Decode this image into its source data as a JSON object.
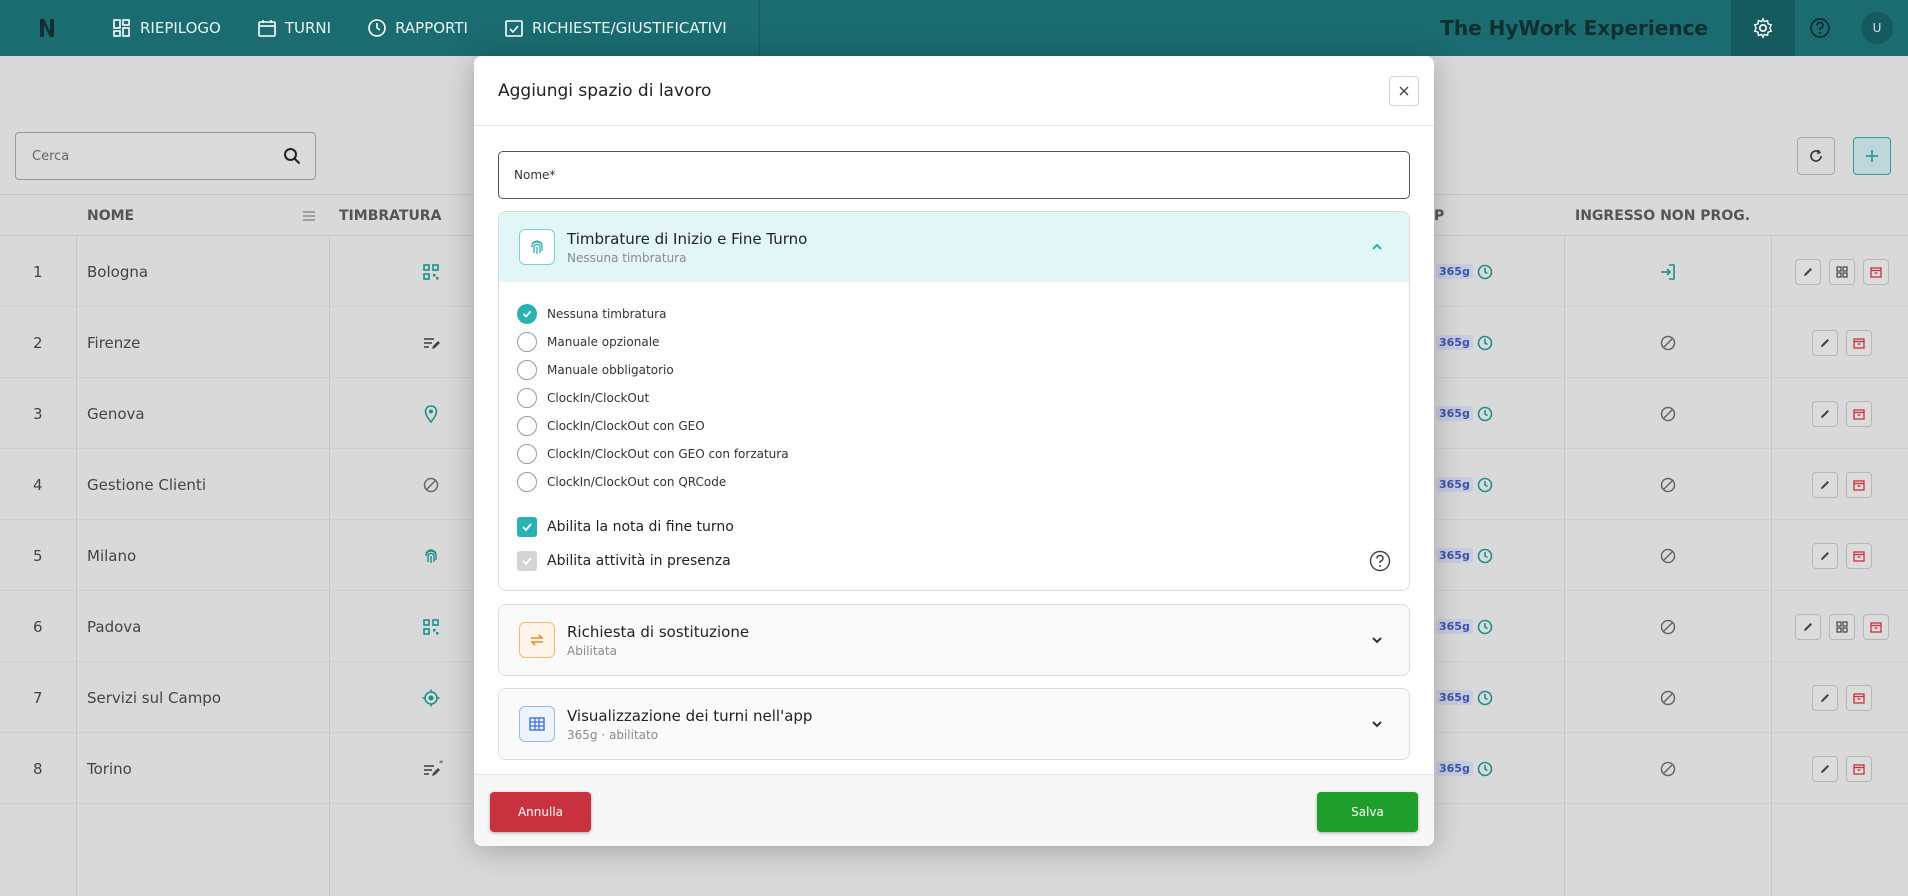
{
  "nav": {
    "items": [
      {
        "label": "RIEPILOGO",
        "icon": "dashboard-icon"
      },
      {
        "label": "TURNI",
        "icon": "calendar-icon"
      },
      {
        "label": "RAPPORTI",
        "icon": "clock-icon"
      },
      {
        "label": "RICHIESTE/GIUSTIFICATIVI",
        "icon": "check-calendar-icon"
      }
    ],
    "brand": "The HyWork Experience",
    "avatar": "U"
  },
  "search": {
    "placeholder": "Cerca"
  },
  "table": {
    "headers": {
      "nome": "NOME",
      "timbratura": "TIMBRATURA",
      "app": "P",
      "ingresso": "INGRESSO NON PROG."
    },
    "rows": [
      {
        "num": "1",
        "name": "Bologna",
        "tag": "365g",
        "icon": "qrcode-icon"
      },
      {
        "num": "2",
        "name": "Firenze",
        "tag": "365g",
        "icon": "manual-edit-icon"
      },
      {
        "num": "3",
        "name": "Genova",
        "tag": "365g",
        "icon": "location-pin-icon"
      },
      {
        "num": "4",
        "name": "Gestione Clienti",
        "tag": "365g",
        "icon": "blocked-icon"
      },
      {
        "num": "5",
        "name": "Milano",
        "tag": "365g",
        "icon": "fingerprint-icon"
      },
      {
        "num": "6",
        "name": "Padova",
        "tag": "365g",
        "icon": "qrcode-icon"
      },
      {
        "num": "7",
        "name": "Servizi sul Campo",
        "tag": "365g",
        "icon": "gps-target-icon"
      },
      {
        "num": "8",
        "name": "Torino",
        "tag": "365g",
        "icon": "manual-edit-required-icon"
      }
    ]
  },
  "modal": {
    "title": "Aggiungi spazio di lavoro",
    "name_placeholder": "Nome*",
    "section_timbrature": {
      "title": "Timbrature di Inizio e Fine Turno",
      "subtitle": "Nessuna timbratura",
      "options": [
        "Nessuna timbratura",
        "Manuale opzionale",
        "Manuale obbligatorio",
        "ClockIn/ClockOut",
        "ClockIn/ClockOut con GEO",
        "ClockIn/ClockOut con GEO con forzatura",
        "ClockIn/ClockOut con QRCode"
      ],
      "selected": "Nessuna timbratura",
      "check_nota": "Abilita la nota di fine turno",
      "check_presenza": "Abilita attività in presenza"
    },
    "section_sostituzione": {
      "title": "Richiesta di sostituzione",
      "subtitle": "Abilitata"
    },
    "section_visualizzazione": {
      "title": "Visualizzazione dei turni nell'app",
      "subtitle": "365g · abilitato"
    },
    "cancel_label": "Annulla",
    "save_label": "Salva"
  },
  "colors": {
    "navbar": "#1a6c70",
    "accent": "#2bb2b0",
    "cancel": "#c8323f",
    "save": "#1f9e2c"
  }
}
